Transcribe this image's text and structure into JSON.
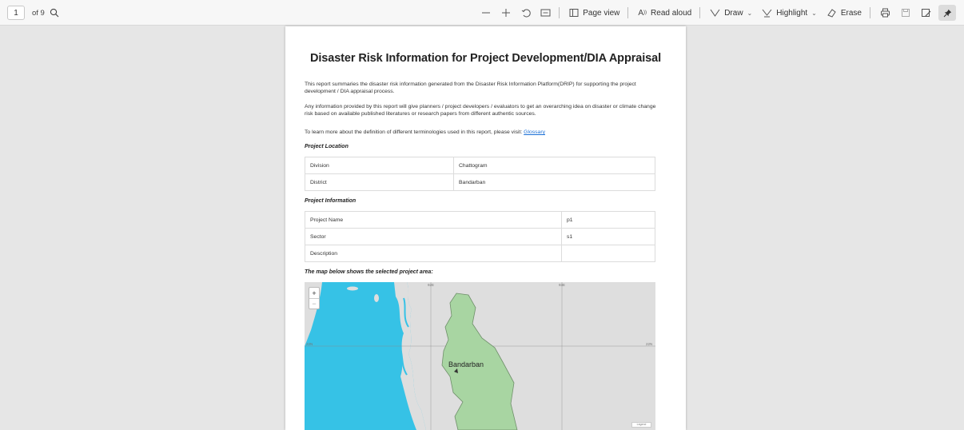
{
  "toolbar": {
    "page_number": "1",
    "page_of": "of 9",
    "page_view_label": "Page view",
    "read_aloud_label": "Read aloud",
    "draw_label": "Draw",
    "highlight_label": "Highlight",
    "erase_label": "Erase"
  },
  "document": {
    "title": "Disaster Risk Information for Project Development/DIA Appraisal",
    "para1": "This report summaries the disaster risk information generated from the Disaster Risk Information Platform(DRIP) for supporting the project development / DIA appraisal process.",
    "para2": "Any information provided by this report will give planners / project developers / evaluators to get an overarching idea on disaster or climate change risk based on available published literatures or research papers from different authentic sources.",
    "para3_text": "To learn more about the definition of different terminologies used in this report, please visit:",
    "glossary_link": "Glossary",
    "location_heading": "Project Location",
    "location_rows": [
      {
        "label": "Division",
        "value": "Chattogram"
      },
      {
        "label": "District",
        "value": "Bandarban"
      }
    ],
    "info_heading": "Project Information",
    "info_rows": [
      {
        "label": "Project Name",
        "value": "p1"
      },
      {
        "label": "Sector",
        "value": "s1"
      },
      {
        "label": "Description",
        "value": ""
      }
    ],
    "map_heading": "The map below shows the selected project area:",
    "map": {
      "region_label": "Bandarban",
      "lon_label_1": "92E",
      "lon_label_2": "93E",
      "lat_label_left": "22N",
      "lat_label_right": "22N",
      "zoom_in": "+",
      "zoom_out": "−",
      "legend_tag": "Legend",
      "water_color": "#36c2e6",
      "region_color": "#a8d5a2"
    }
  }
}
